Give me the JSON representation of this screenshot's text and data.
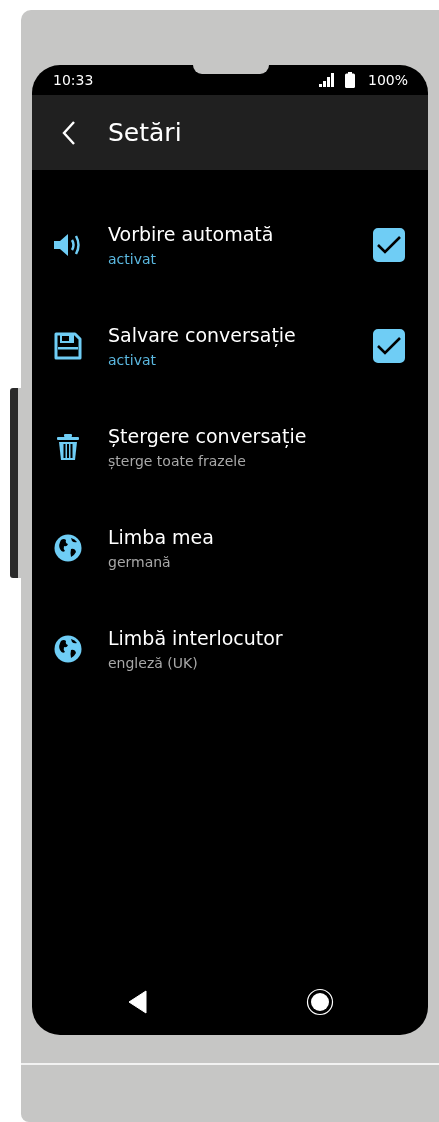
{
  "status_bar": {
    "time": "10:33",
    "battery": "100%"
  },
  "app_bar": {
    "title": "Setări"
  },
  "settings": [
    {
      "kind": "checkbox",
      "title": "Vorbire automată",
      "subtitle": "activat",
      "checked": true
    },
    {
      "kind": "checkbox",
      "title": "Salvare conversație",
      "subtitle": "activat",
      "checked": true
    },
    {
      "kind": "plain",
      "title": "Ștergere conversație",
      "subtitle": "șterge toate frazele"
    },
    {
      "kind": "plain",
      "title": "Limba mea",
      "subtitle": "germană"
    },
    {
      "kind": "plain",
      "title": "Limbă interlocutor",
      "subtitle": "engleză (UK)"
    }
  ]
}
